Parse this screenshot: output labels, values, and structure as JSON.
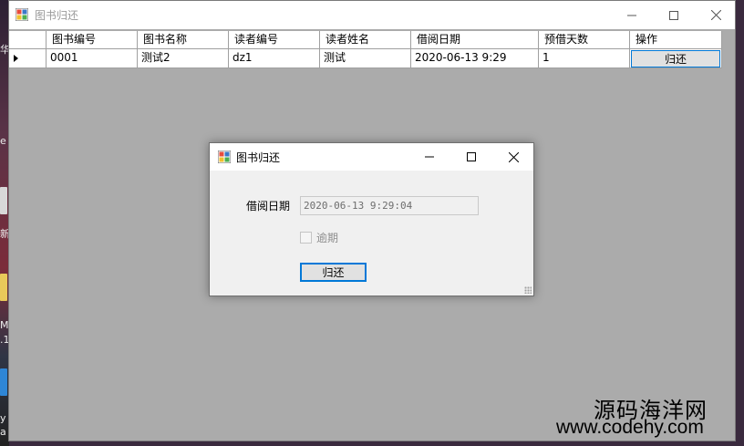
{
  "window": {
    "title": "图书归还"
  },
  "grid": {
    "columns": [
      "图书编号",
      "图书名称",
      "读者编号",
      "读者姓名",
      "借阅日期",
      "预借天数",
      "操作"
    ],
    "rows": [
      {
        "book_id": "0001",
        "book_name": "测试2",
        "reader_id": "dz1",
        "reader_name": "测试",
        "borrow_date": "2020-06-13 9:29",
        "days": "1",
        "action": "归还"
      }
    ]
  },
  "dialog": {
    "title": "图书归还",
    "date_label": "借阅日期",
    "date_value": "2020-06-13 9:29:04",
    "overdue_label": "逾期",
    "return_button": "归还"
  },
  "desktop_glyphs": [
    "华",
    "e",
    "新",
    "M",
    ".1",
    "y",
    "a"
  ],
  "watermark": {
    "line1": "源码海洋网",
    "line2": "www.codehy.com"
  },
  "colors": {
    "accent": "#0078d7",
    "window_bg": "#ababab",
    "dialog_bg": "#f0f0f0"
  }
}
